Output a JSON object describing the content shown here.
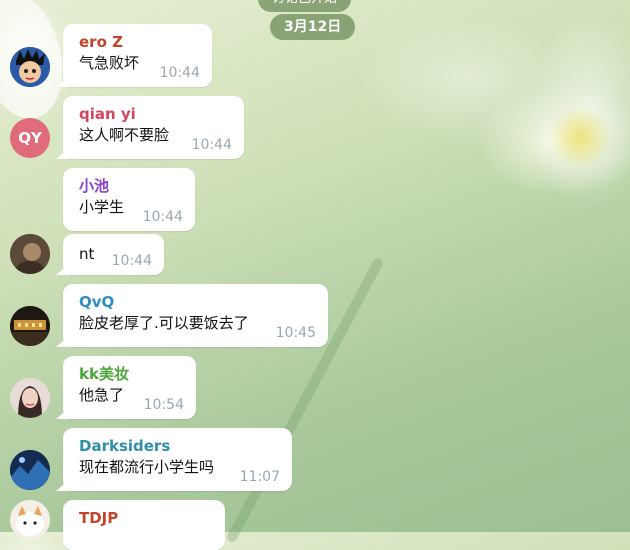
{
  "header": {
    "top_pill": "讨论已开始",
    "date": "3月12日"
  },
  "messages": [
    {
      "name": "ero Z",
      "name_color": "#c2452b",
      "text": "气急败坏",
      "time": "10:44",
      "avatar": "anime-avatar"
    },
    {
      "name": "qian yi",
      "name_color": "#d2475e",
      "text": "这人啊不要脸",
      "time": "10:44",
      "avatar_initials": "QY",
      "avatar_color": "#e06b7a"
    },
    {
      "name": "小池",
      "name_color": "#8a3fd1",
      "text": "小学生",
      "time": "10:44",
      "avatar": "none"
    },
    {
      "name": "",
      "text": "nt",
      "time": "10:44",
      "avatar": "photo-avatar-brown"
    },
    {
      "name": "QvQ",
      "name_color": "#2f8cc7",
      "text": "脸皮老厚了.可以要饭去了",
      "time": "10:45",
      "avatar": "photo-avatar-building"
    },
    {
      "name": "kk美妆",
      "name_color": "#4aa63b",
      "text": "他急了",
      "time": "10:54",
      "avatar": "photo-avatar-woman"
    },
    {
      "name": "Darksiders",
      "name_color": "#2f8fa8",
      "text": "现在都流行小学生吗",
      "time": "11:07",
      "avatar": "photo-avatar-blue"
    },
    {
      "name": "TDJP",
      "name_color": "#c2452b",
      "text": "",
      "time": "",
      "avatar": "cat-avatar"
    }
  ]
}
